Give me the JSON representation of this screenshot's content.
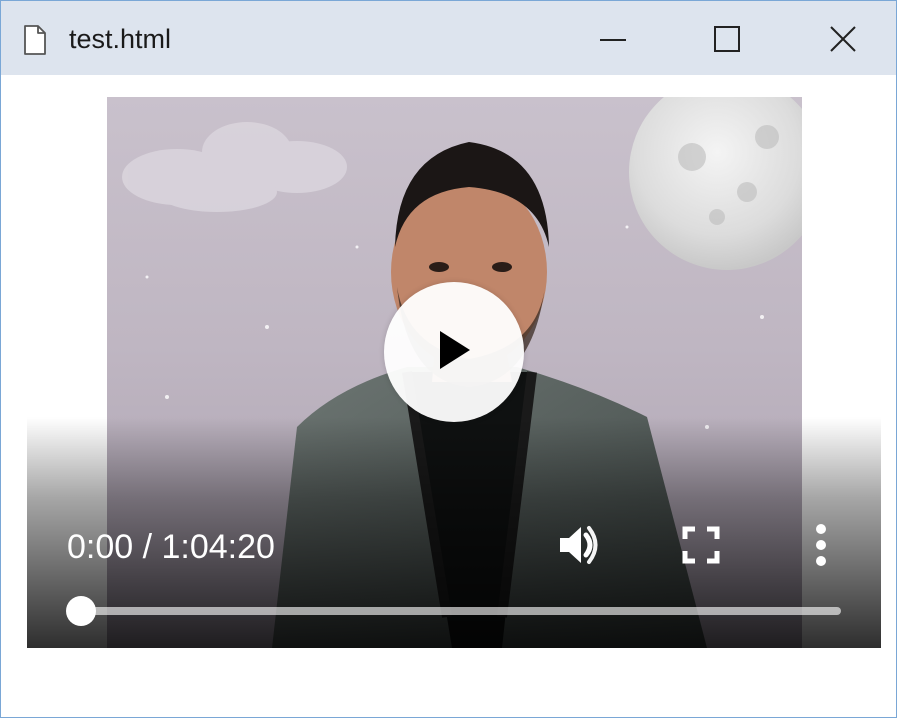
{
  "window": {
    "title": "test.html",
    "icons": {
      "document": "document-icon",
      "minimize": "minimize-icon",
      "maximize": "maximize-icon",
      "close": "close-icon"
    }
  },
  "video_player": {
    "current_time": "0:00",
    "duration": "1:04:20",
    "time_text": "0:00 / 1:04:20",
    "progress_fraction": 0,
    "icons": {
      "big_play": "play-icon",
      "volume": "volume-icon",
      "fullscreen": "fullscreen-icon",
      "more": "more-vertical-icon"
    }
  },
  "colors": {
    "titlebar_bg": "#dde4ee",
    "window_border": "#7aa7d6",
    "controls_text": "#ffffff"
  }
}
